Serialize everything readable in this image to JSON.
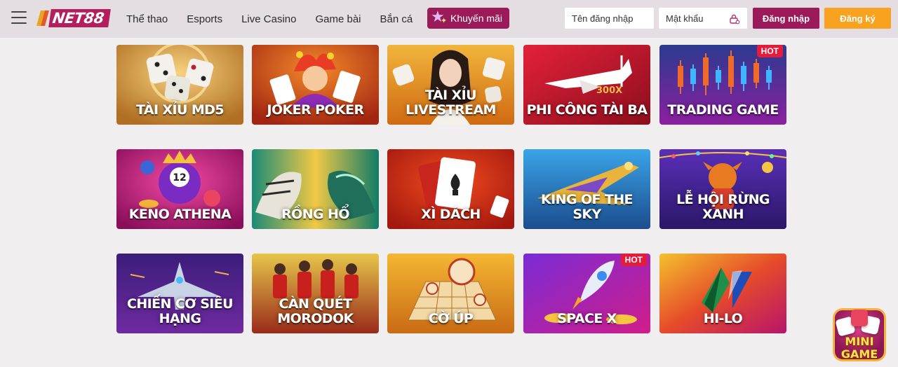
{
  "header": {
    "logo_text": "NET88",
    "nav": [
      "Thể thao",
      "Esports",
      "Live Casino",
      "Game bài",
      "Bắn cá"
    ],
    "promo_label": "Khuyến mãi",
    "username_placeholder": "Tên đăng nhập",
    "password_placeholder": "Mật khẩu",
    "login_label": "Đăng nhập",
    "register_label": "Đăng ký"
  },
  "games": [
    {
      "title": "TÀI XỈU MD5",
      "badge": "",
      "theme": "tai-xiu-md5"
    },
    {
      "title": "JOKER POKER",
      "badge": "",
      "theme": "joker-poker"
    },
    {
      "title": "TÀI XỈU LIVESTREAM",
      "badge": "",
      "theme": "tai-xiu-livestream"
    },
    {
      "title": "PHI CÔNG TÀI BA",
      "badge": "",
      "caption": "300X",
      "theme": "phi-cong-tai-ba"
    },
    {
      "title": "TRADING GAME",
      "badge": "HOT",
      "theme": "trading-game"
    },
    {
      "title": "KENO ATHENA",
      "badge": "",
      "theme": "keno-athena"
    },
    {
      "title": "RỒNG HỔ",
      "badge": "",
      "theme": "rong-ho"
    },
    {
      "title": "XÌ DÁCH",
      "badge": "",
      "theme": "xi-dach"
    },
    {
      "title": "KING OF THE SKY",
      "badge": "",
      "theme": "king-of-the-sky"
    },
    {
      "title": "LỄ HỘI RỪNG XANH",
      "badge": "",
      "theme": "le-hoi-rung-xanh"
    },
    {
      "title": "CHIẾN CƠ SIÊU HẠNG",
      "badge": "",
      "theme": "chien-co-sieu-hang"
    },
    {
      "title": "CÀN QUÉT MORODOK",
      "badge": "",
      "theme": "can-quet-morodok"
    },
    {
      "title": "CỜ ÚP",
      "badge": "",
      "theme": "co-up"
    },
    {
      "title": "SPACE X",
      "badge": "HOT",
      "theme": "space-x"
    },
    {
      "title": "HI-LO",
      "badge": "",
      "theme": "hi-lo"
    }
  ],
  "floating": {
    "line1": "MINI",
    "line2": "GAME"
  },
  "colors": {
    "brand": "#9b1a59",
    "accent": "#f7a320",
    "hot": "#e21c3a",
    "topbar": "#e4dee2"
  }
}
